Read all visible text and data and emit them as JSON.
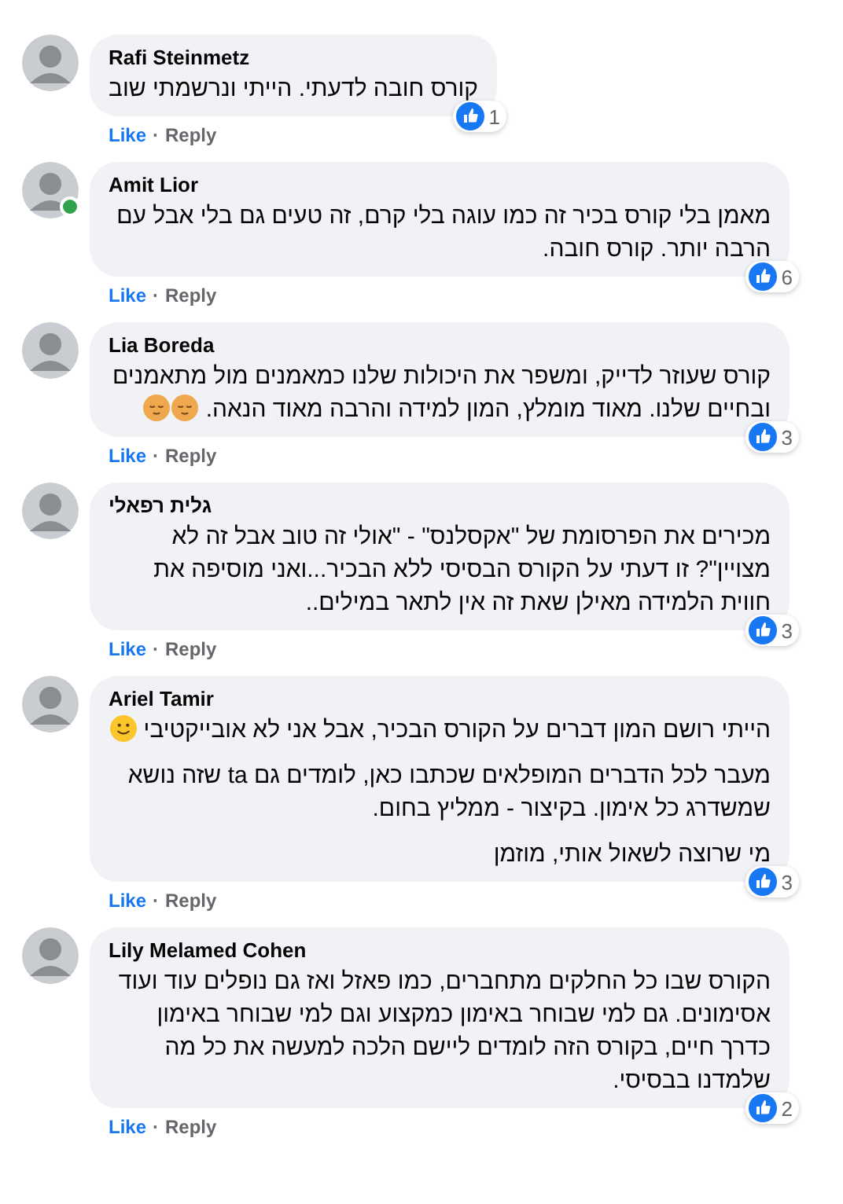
{
  "comments": [
    {
      "author": "Rafi Steinmetz",
      "online": false,
      "paragraphs": [
        {
          "text": "קורס חובה לדעתי. הייתי ונרשמתי שוב"
        }
      ],
      "reactions": "1",
      "like": "Like",
      "separator": "·",
      "reply": "Reply"
    },
    {
      "author": "Amit Lior",
      "online": true,
      "paragraphs": [
        {
          "text": "מאמן בלי קורס בכיר זה כמו עוגה בלי קרם, זה טעים גם בלי אבל עם הרבה יותר. קורס חובה."
        }
      ],
      "reactions": "6",
      "like": "Like",
      "separator": "·",
      "reply": "Reply"
    },
    {
      "author": "Lia Boreda",
      "online": false,
      "paragraphs": [
        {
          "text": "קורס שעוזר לדייק, ומשפר את היכולות שלנו כמאמנים מול מתאמנים ובחיים שלנו. מאוד מומלץ, המון למידה והרבה מאוד הנאה.",
          "emojis": [
            {
              "kind": "relieved"
            },
            {
              "kind": "relieved"
            }
          ]
        }
      ],
      "reactions": "3",
      "like": "Like",
      "separator": "·",
      "reply": "Reply"
    },
    {
      "author": "גלית רפאלי",
      "online": false,
      "paragraphs": [
        {
          "text": "מכירים את הפרסומת של \"אקסלנס\" - \"אולי זה טוב אבל זה לא מצויין\"? זו דעתי על הקורס הבסיסי ללא הבכיר...ואני מוסיפה את חווית הלמידה מאילן שאת זה אין לתאר במילים.."
        }
      ],
      "reactions": "3",
      "like": "Like",
      "separator": "·",
      "reply": "Reply"
    },
    {
      "author": "Ariel Tamir",
      "online": false,
      "paragraphs": [
        {
          "text": "הייתי רושם המון דברים על הקורס הבכיר, אבל אני לא אובייקטיבי",
          "emojis": [
            {
              "kind": "smile"
            }
          ]
        },
        {
          "text": "מעבר לכל הדברים המופלאים שכתבו כאן, לומדים גם ta שזה נושא שמשדרג כל אימון. בקיצור - ממליץ בחום."
        },
        {
          "text": "מי שרוצה לשאול אותי, מוזמן"
        }
      ],
      "reactions": "3",
      "like": "Like",
      "separator": "·",
      "reply": "Reply"
    },
    {
      "author": "Lily Melamed Cohen",
      "online": false,
      "paragraphs": [
        {
          "text": "הקורס שבו כל החלקים מתחברים, כמו פאזל ואז גם נופלים עוד ועוד אסימונים. גם למי שבוחר באימון כמקצוע וגם למי שבוחר באימון כדרך חיים, בקורס הזה לומדים ליישם הלכה למעשה את כל מה שלמדנו בבסיסי."
        }
      ],
      "reactions": "2",
      "like": "Like",
      "separator": "·",
      "reply": "Reply"
    }
  ]
}
